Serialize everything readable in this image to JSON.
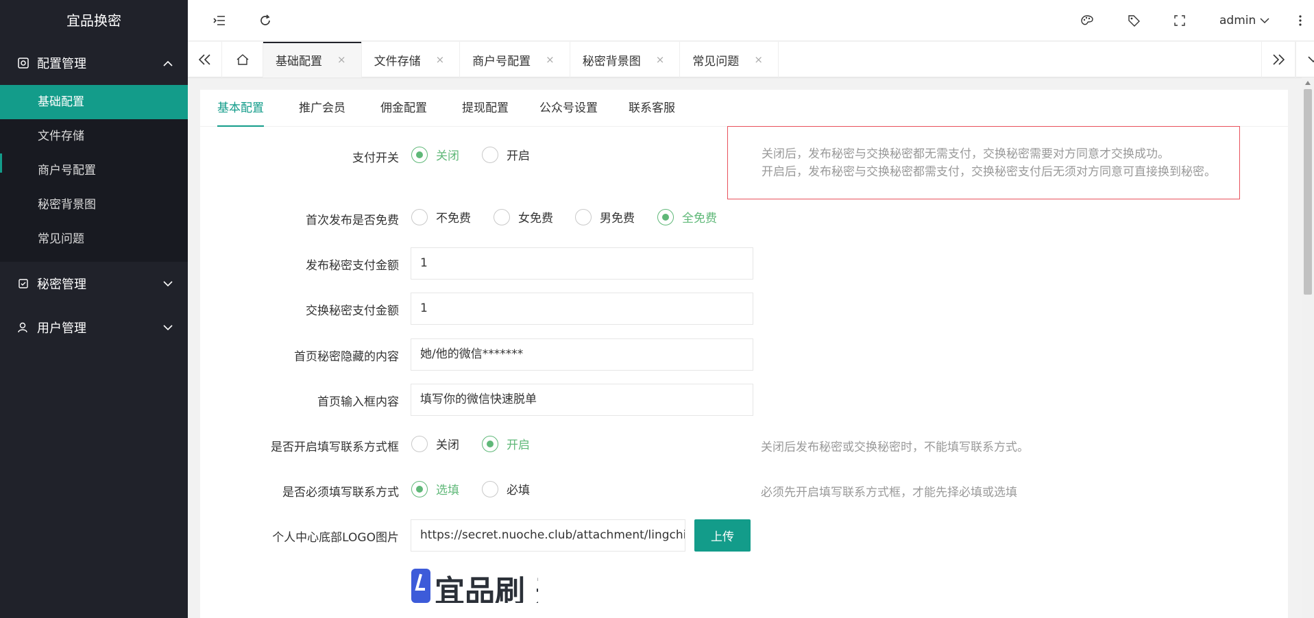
{
  "app": {
    "title": "宜品换密"
  },
  "sidebar": {
    "groups": [
      {
        "label": "配置管理",
        "icon": "settings-icon",
        "expanded": true,
        "items": [
          {
            "label": "基础配置",
            "active": true
          },
          {
            "label": "文件存储"
          },
          {
            "label": "商户号配置"
          },
          {
            "label": "秘密背景图"
          },
          {
            "label": "常见问题"
          }
        ]
      },
      {
        "label": "秘密管理",
        "icon": "secret-icon",
        "expanded": false
      },
      {
        "label": "用户管理",
        "icon": "user-icon",
        "expanded": false
      }
    ]
  },
  "topbar": {
    "user": "admin",
    "icons": [
      "menu-fold-icon",
      "refresh-icon",
      "theme-icon",
      "tag-icon",
      "fullscreen-icon",
      "more-icon"
    ]
  },
  "tabs": {
    "items": [
      {
        "label": "基础配置",
        "active": true
      },
      {
        "label": "文件存储"
      },
      {
        "label": "商户号配置"
      },
      {
        "label": "秘密背景图"
      },
      {
        "label": "常见问题"
      }
    ],
    "close": "×"
  },
  "subtabs": [
    "基本配置",
    "推广会员",
    "佣金配置",
    "提现配置",
    "公众号设置",
    "联系客服"
  ],
  "form": {
    "pay_switch": {
      "label": "支付开关",
      "options": [
        "关闭",
        "开启"
      ],
      "selected": "关闭",
      "hint_line1": "关闭后，发布秘密与交换秘密都无需支付，交换秘密需要对方同意才交换成功。",
      "hint_line2": "开启后，发布秘密与交换秘密都需支付，交换秘密支付后无须对方同意可直接换到秘密。"
    },
    "first_free": {
      "label": "首次发布是否免费",
      "options": [
        "不免费",
        "女免费",
        "男免费",
        "全免费"
      ],
      "selected": "全免费"
    },
    "publish_amount": {
      "label": "发布秘密支付金额",
      "value": "1"
    },
    "exchange_amount": {
      "label": "交换秘密支付金额",
      "value": "1"
    },
    "hidden_content": {
      "label": "首页秘密隐藏的内容",
      "value": "她/他的微信*******"
    },
    "input_content": {
      "label": "首页输入框内容",
      "value": "填写你的微信快速脱单"
    },
    "contact_open": {
      "label": "是否开启填写联系方式框",
      "options": [
        "关闭",
        "开启"
      ],
      "selected": "开启",
      "hint": "关闭后发布秘密或交换秘密时，不能填写联系方式。"
    },
    "contact_required": {
      "label": "是否必须填写联系方式",
      "options": [
        "选填",
        "必填"
      ],
      "selected": "选填",
      "hint": "必须先开启填写联系方式框，才能先择必填或选填"
    },
    "logo": {
      "label": "个人中心底部LOGO图片",
      "value": "https://secret.nuoche.club/attachment/lingchi_swa",
      "button": "上传",
      "preview_text": "宜品刷 开发"
    }
  },
  "colors": {
    "accent": "#139c8a",
    "radio_on": "#5fb878",
    "sidebar_bg": "#20222a",
    "hint_border": "#e8505b"
  }
}
